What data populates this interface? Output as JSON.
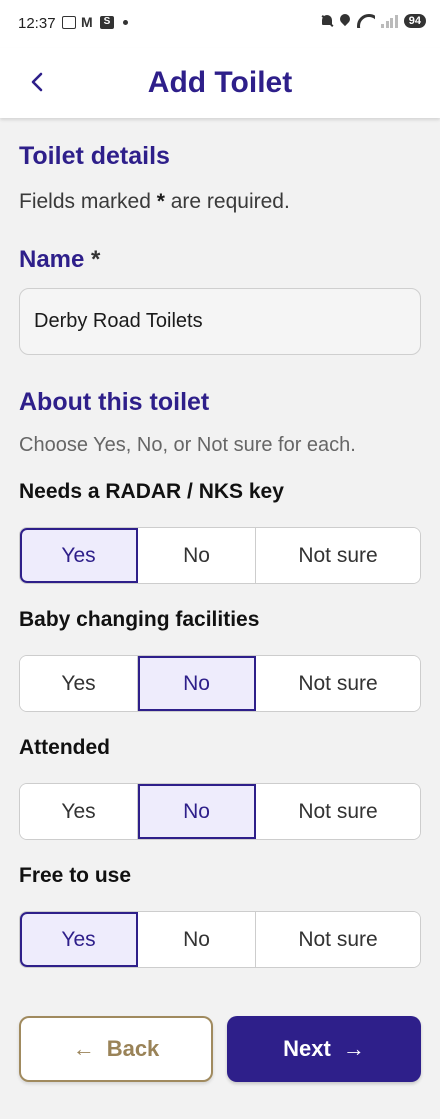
{
  "status_bar": {
    "time": "12:37",
    "battery": "94"
  },
  "header": {
    "title": "Add Toilet"
  },
  "details": {
    "title": "Toilet details",
    "required_note_prefix": "Fields marked ",
    "required_note_star": "*",
    "required_note_suffix": " are required."
  },
  "name_field": {
    "label": "Name",
    "required_mark": "*",
    "value": "Derby Road Toilets"
  },
  "about": {
    "title": "About this toilet",
    "hint": "Choose Yes, No, or Not sure for each."
  },
  "options": [
    "Yes",
    "No",
    "Not sure"
  ],
  "questions": [
    {
      "label": "Needs a RADAR / NKS key",
      "selected": "Yes"
    },
    {
      "label": "Baby changing facilities",
      "selected": "No"
    },
    {
      "label": "Attended",
      "selected": "No"
    },
    {
      "label": "Free to use",
      "selected": "Yes"
    }
  ],
  "footer": {
    "back_label": "Back",
    "next_label": "Next"
  },
  "colors": {
    "primary": "#2e1f8a",
    "selected_bg": "#eeecfc",
    "back_accent": "#9a8358"
  },
  "icons": {
    "header_back": "chevron-left-icon",
    "back_button": "arrow-left-icon",
    "next_button": "arrow-right-icon"
  }
}
